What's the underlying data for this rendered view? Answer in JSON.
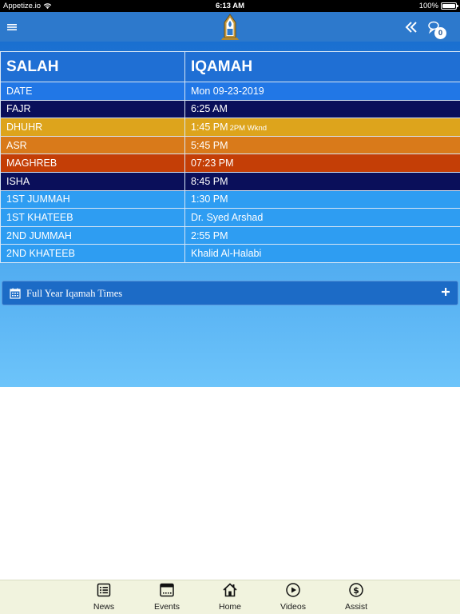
{
  "status_bar": {
    "carrier": "Appetize.io",
    "time": "6:13 AM",
    "battery": "100%",
    "battery_level": 1.0
  },
  "nav": {
    "notification_count": "0"
  },
  "table": {
    "headers": [
      "SALAH",
      "IQAMAH"
    ],
    "rows": [
      {
        "name": "DATE",
        "value": "Mon 09-23-2019",
        "note": "",
        "color": "#2177e6"
      },
      {
        "name": "FAJR",
        "value": "6:25 AM",
        "note": "",
        "color": "#0a0f5a"
      },
      {
        "name": "DHUHR",
        "value": "1:45 PM",
        "note": "2PM Wknd",
        "color": "#dda41c"
      },
      {
        "name": "ASR",
        "value": "5:45 PM",
        "note": "",
        "color": "#d97a1a"
      },
      {
        "name": "MAGHREB",
        "value": "07:23 PM",
        "note": "",
        "color": "#c43e06"
      },
      {
        "name": "ISHA",
        "value": "8:45 PM",
        "note": "",
        "color": "#0a0f5a"
      },
      {
        "name": "1ST JUMMAH",
        "value": "1:30 PM",
        "note": "",
        "color": "#2e9df2"
      },
      {
        "name": "1ST KHATEEB",
        "value": "Dr. Syed Arshad",
        "note": "",
        "color": "#2e9df2"
      },
      {
        "name": "2ND JUMMAH",
        "value": "2:55 PM",
        "note": "",
        "color": "#2e9df2"
      },
      {
        "name": "2ND KHATEEB",
        "value": "Khalid Al-Halabi",
        "note": "",
        "color": "#2e9df2"
      }
    ]
  },
  "accordion": {
    "title": "Full Year Iqamah Times"
  },
  "tabs": [
    {
      "label": "News",
      "icon": "news-icon"
    },
    {
      "label": "Events",
      "icon": "calendar-icon"
    },
    {
      "label": "Home",
      "icon": "home-icon"
    },
    {
      "label": "Videos",
      "icon": "play-icon"
    },
    {
      "label": "Assist",
      "icon": "dollar-icon"
    }
  ]
}
